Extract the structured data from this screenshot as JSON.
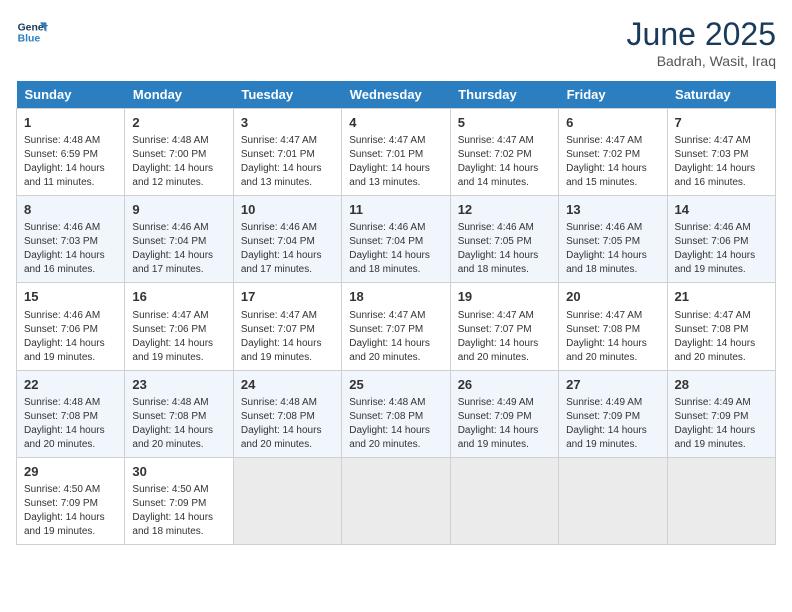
{
  "logo": {
    "line1": "General",
    "line2": "Blue"
  },
  "title": "June 2025",
  "subtitle": "Badrah, Wasit, Iraq",
  "days_of_week": [
    "Sunday",
    "Monday",
    "Tuesday",
    "Wednesday",
    "Thursday",
    "Friday",
    "Saturday"
  ],
  "weeks": [
    [
      {
        "day": "1",
        "sunrise": "Sunrise: 4:48 AM",
        "sunset": "Sunset: 6:59 PM",
        "daylight": "Daylight: 14 hours and 11 minutes."
      },
      {
        "day": "2",
        "sunrise": "Sunrise: 4:48 AM",
        "sunset": "Sunset: 7:00 PM",
        "daylight": "Daylight: 14 hours and 12 minutes."
      },
      {
        "day": "3",
        "sunrise": "Sunrise: 4:47 AM",
        "sunset": "Sunset: 7:01 PM",
        "daylight": "Daylight: 14 hours and 13 minutes."
      },
      {
        "day": "4",
        "sunrise": "Sunrise: 4:47 AM",
        "sunset": "Sunset: 7:01 PM",
        "daylight": "Daylight: 14 hours and 13 minutes."
      },
      {
        "day": "5",
        "sunrise": "Sunrise: 4:47 AM",
        "sunset": "Sunset: 7:02 PM",
        "daylight": "Daylight: 14 hours and 14 minutes."
      },
      {
        "day": "6",
        "sunrise": "Sunrise: 4:47 AM",
        "sunset": "Sunset: 7:02 PM",
        "daylight": "Daylight: 14 hours and 15 minutes."
      },
      {
        "day": "7",
        "sunrise": "Sunrise: 4:47 AM",
        "sunset": "Sunset: 7:03 PM",
        "daylight": "Daylight: 14 hours and 16 minutes."
      }
    ],
    [
      {
        "day": "8",
        "sunrise": "Sunrise: 4:46 AM",
        "sunset": "Sunset: 7:03 PM",
        "daylight": "Daylight: 14 hours and 16 minutes."
      },
      {
        "day": "9",
        "sunrise": "Sunrise: 4:46 AM",
        "sunset": "Sunset: 7:04 PM",
        "daylight": "Daylight: 14 hours and 17 minutes."
      },
      {
        "day": "10",
        "sunrise": "Sunrise: 4:46 AM",
        "sunset": "Sunset: 7:04 PM",
        "daylight": "Daylight: 14 hours and 17 minutes."
      },
      {
        "day": "11",
        "sunrise": "Sunrise: 4:46 AM",
        "sunset": "Sunset: 7:04 PM",
        "daylight": "Daylight: 14 hours and 18 minutes."
      },
      {
        "day": "12",
        "sunrise": "Sunrise: 4:46 AM",
        "sunset": "Sunset: 7:05 PM",
        "daylight": "Daylight: 14 hours and 18 minutes."
      },
      {
        "day": "13",
        "sunrise": "Sunrise: 4:46 AM",
        "sunset": "Sunset: 7:05 PM",
        "daylight": "Daylight: 14 hours and 18 minutes."
      },
      {
        "day": "14",
        "sunrise": "Sunrise: 4:46 AM",
        "sunset": "Sunset: 7:06 PM",
        "daylight": "Daylight: 14 hours and 19 minutes."
      }
    ],
    [
      {
        "day": "15",
        "sunrise": "Sunrise: 4:46 AM",
        "sunset": "Sunset: 7:06 PM",
        "daylight": "Daylight: 14 hours and 19 minutes."
      },
      {
        "day": "16",
        "sunrise": "Sunrise: 4:47 AM",
        "sunset": "Sunset: 7:06 PM",
        "daylight": "Daylight: 14 hours and 19 minutes."
      },
      {
        "day": "17",
        "sunrise": "Sunrise: 4:47 AM",
        "sunset": "Sunset: 7:07 PM",
        "daylight": "Daylight: 14 hours and 19 minutes."
      },
      {
        "day": "18",
        "sunrise": "Sunrise: 4:47 AM",
        "sunset": "Sunset: 7:07 PM",
        "daylight": "Daylight: 14 hours and 20 minutes."
      },
      {
        "day": "19",
        "sunrise": "Sunrise: 4:47 AM",
        "sunset": "Sunset: 7:07 PM",
        "daylight": "Daylight: 14 hours and 20 minutes."
      },
      {
        "day": "20",
        "sunrise": "Sunrise: 4:47 AM",
        "sunset": "Sunset: 7:08 PM",
        "daylight": "Daylight: 14 hours and 20 minutes."
      },
      {
        "day": "21",
        "sunrise": "Sunrise: 4:47 AM",
        "sunset": "Sunset: 7:08 PM",
        "daylight": "Daylight: 14 hours and 20 minutes."
      }
    ],
    [
      {
        "day": "22",
        "sunrise": "Sunrise: 4:48 AM",
        "sunset": "Sunset: 7:08 PM",
        "daylight": "Daylight: 14 hours and 20 minutes."
      },
      {
        "day": "23",
        "sunrise": "Sunrise: 4:48 AM",
        "sunset": "Sunset: 7:08 PM",
        "daylight": "Daylight: 14 hours and 20 minutes."
      },
      {
        "day": "24",
        "sunrise": "Sunrise: 4:48 AM",
        "sunset": "Sunset: 7:08 PM",
        "daylight": "Daylight: 14 hours and 20 minutes."
      },
      {
        "day": "25",
        "sunrise": "Sunrise: 4:48 AM",
        "sunset": "Sunset: 7:08 PM",
        "daylight": "Daylight: 14 hours and 20 minutes."
      },
      {
        "day": "26",
        "sunrise": "Sunrise: 4:49 AM",
        "sunset": "Sunset: 7:09 PM",
        "daylight": "Daylight: 14 hours and 19 minutes."
      },
      {
        "day": "27",
        "sunrise": "Sunrise: 4:49 AM",
        "sunset": "Sunset: 7:09 PM",
        "daylight": "Daylight: 14 hours and 19 minutes."
      },
      {
        "day": "28",
        "sunrise": "Sunrise: 4:49 AM",
        "sunset": "Sunset: 7:09 PM",
        "daylight": "Daylight: 14 hours and 19 minutes."
      }
    ],
    [
      {
        "day": "29",
        "sunrise": "Sunrise: 4:50 AM",
        "sunset": "Sunset: 7:09 PM",
        "daylight": "Daylight: 14 hours and 19 minutes."
      },
      {
        "day": "30",
        "sunrise": "Sunrise: 4:50 AM",
        "sunset": "Sunset: 7:09 PM",
        "daylight": "Daylight: 14 hours and 18 minutes."
      },
      null,
      null,
      null,
      null,
      null
    ]
  ]
}
